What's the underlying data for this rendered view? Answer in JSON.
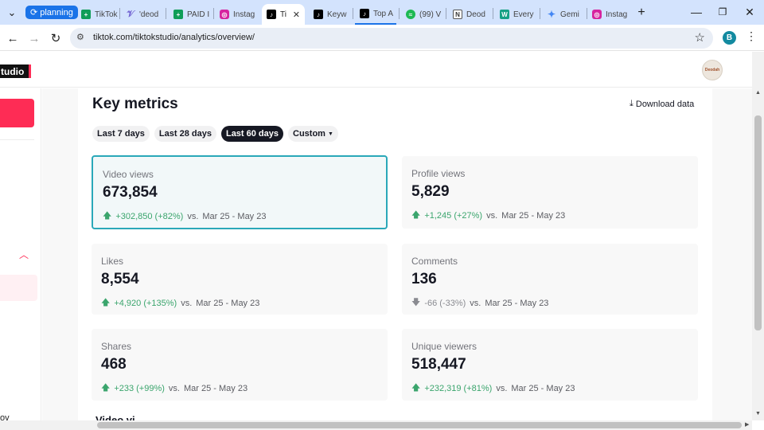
{
  "browser": {
    "tab_group": "planning",
    "tabs": [
      {
        "label": "TikTok",
        "fav": "sheets-icon",
        "color": "#0f9d58"
      },
      {
        "label": "'deod",
        "fav": "feather-icon",
        "color": "#6f5fd0"
      },
      {
        "label": "PAID I",
        "fav": "sheets-icon",
        "color": "#0f9d58"
      },
      {
        "label": "Instag",
        "fav": "instagram-icon",
        "color": "#d6249f"
      },
      {
        "label": "Ti",
        "fav": "tiktok-icon",
        "color": "#000000"
      },
      {
        "label": "Keyw",
        "fav": "tiktok-icon",
        "color": "#000000"
      },
      {
        "label": "Top A",
        "fav": "tiktok-icon",
        "color": "#000000"
      },
      {
        "label": "(99) V",
        "fav": "spotify-icon",
        "color": "#1db954"
      },
      {
        "label": "Deod",
        "fav": "notion-icon",
        "color": "#333333"
      },
      {
        "label": "Every",
        "fav": "wordtune-icon",
        "color": "#16a085"
      },
      {
        "label": "Gemi",
        "fav": "gemini-icon",
        "color": "#4285f4"
      },
      {
        "label": "Instag",
        "fav": "instagram-icon",
        "color": "#d6249f"
      }
    ],
    "url": "tiktok.com/tiktokstudio/analytics/overview/",
    "profile_initial": "B"
  },
  "header": {
    "logo_text": "tudio",
    "avatar_text": "Deodah"
  },
  "sidebar": {
    "cut_text": "ov"
  },
  "key_metrics": {
    "title": "Key metrics",
    "download_label": "Download data",
    "filters": [
      {
        "label": "Last 7 days",
        "active": false
      },
      {
        "label": "Last 28 days",
        "active": false
      },
      {
        "label": "Last 60 days",
        "active": true
      },
      {
        "label": "Custom",
        "active": false
      }
    ],
    "comparison_range": "Mar 25 - May 23",
    "vs_label": "vs.",
    "cards": [
      {
        "label": "Video views",
        "value": "673,854",
        "delta": "+302,850 (+82%)",
        "direction": "up",
        "selected": true
      },
      {
        "label": "Profile views",
        "value": "5,829",
        "delta": "+1,245 (+27%)",
        "direction": "up",
        "selected": false
      },
      {
        "label": "Likes",
        "value": "8,554",
        "delta": "+4,920 (+135%)",
        "direction": "up",
        "selected": false
      },
      {
        "label": "Comments",
        "value": "136",
        "delta": "-66 (-33%)",
        "direction": "down",
        "selected": false
      },
      {
        "label": "Shares",
        "value": "468",
        "delta": "+233 (+99%)",
        "direction": "up",
        "selected": false
      },
      {
        "label": "Unique viewers",
        "value": "518,447",
        "delta": "+232,319 (+81%)",
        "direction": "up",
        "selected": false
      }
    ],
    "next_section_partial": "Video vi"
  },
  "colors": {
    "accent": "#fe2c55",
    "selected_border": "#2aa8b9",
    "positive": "#3ba56d",
    "negative": "#8a8b91"
  }
}
